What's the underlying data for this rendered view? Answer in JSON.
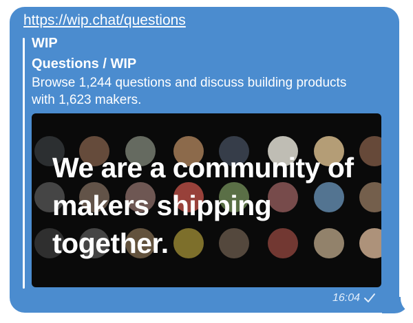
{
  "message": {
    "url": "https://wip.chat/questions",
    "time": "16:04",
    "status_icon": "single-check-icon",
    "bubble_color": "#4b8ccf"
  },
  "link_preview": {
    "site_name": "WIP",
    "title": "Questions / WIP",
    "description": "Browse 1,244 questions and discuss building products with 1,623 makers.",
    "image": {
      "headline": "We are a community of makers shipping together.",
      "background_color": "#0a0a0a"
    }
  }
}
